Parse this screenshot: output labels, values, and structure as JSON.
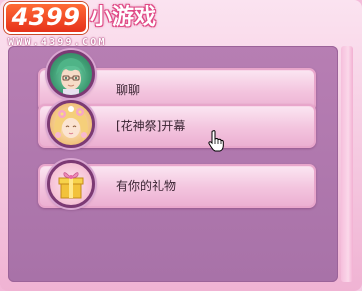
{
  "logo": {
    "brand_number": "4399",
    "brand_name": "小游戏",
    "url": "WWW.4399.COM"
  },
  "menu": {
    "options": [
      {
        "label": "聊聊",
        "avatar": "green-haired-boy-avatar"
      },
      {
        "label": "[花神祭]开幕",
        "avatar": "blonde-flower-girl-avatar"
      },
      {
        "label": "有你的礼物",
        "avatar": "gift-box-avatar"
      }
    ]
  },
  "colors": {
    "panel": "#b77eb3",
    "option_bg": "#f3c4de",
    "avatar_ring": "#7c3a74",
    "text": "#3a2433"
  }
}
